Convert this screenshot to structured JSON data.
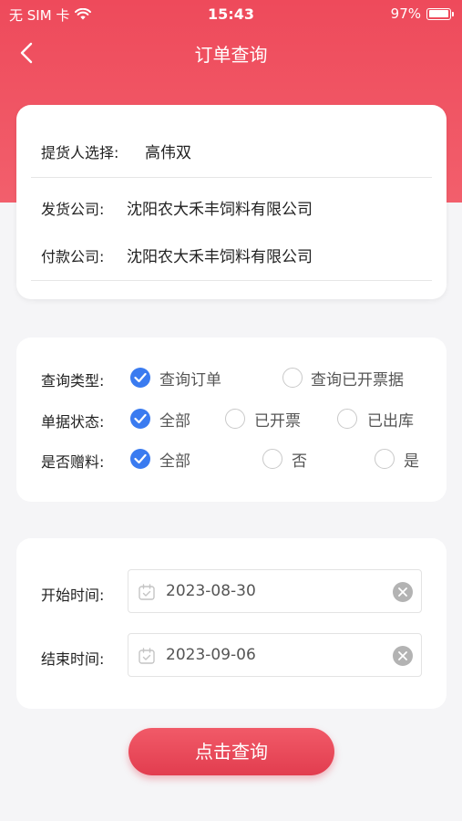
{
  "status_bar": {
    "carrier": "无 SIM 卡",
    "time": "15:43",
    "battery_percent": "97%"
  },
  "nav": {
    "title": "订单查询"
  },
  "picker": {
    "label": "提货人选择:",
    "value": "高伟双"
  },
  "company": {
    "ship_label": "发货公司:",
    "ship_value": "沈阳农大禾丰饲料有限公司",
    "pay_label": "付款公司:",
    "pay_value": "沈阳农大禾丰饲料有限公司"
  },
  "filters": {
    "query_type": {
      "label": "查询类型:",
      "options": [
        "查询订单",
        "查询已开票据"
      ],
      "selected": 0
    },
    "doc_status": {
      "label": "单据状态:",
      "options": [
        "全部",
        "已开票",
        "已出库"
      ],
      "selected": 0
    },
    "gift": {
      "label": "是否赠料:",
      "options": [
        "全部",
        "否",
        "是"
      ],
      "selected": 0
    }
  },
  "dates": {
    "start_label": "开始时间:",
    "start_value": "2023-08-30",
    "end_label": "结束时间:",
    "end_value": "2023-09-06"
  },
  "actions": {
    "query_label": "点击查询"
  },
  "colors": {
    "brand_red": "#ee4a5b",
    "check_blue": "#3a7bf0"
  }
}
